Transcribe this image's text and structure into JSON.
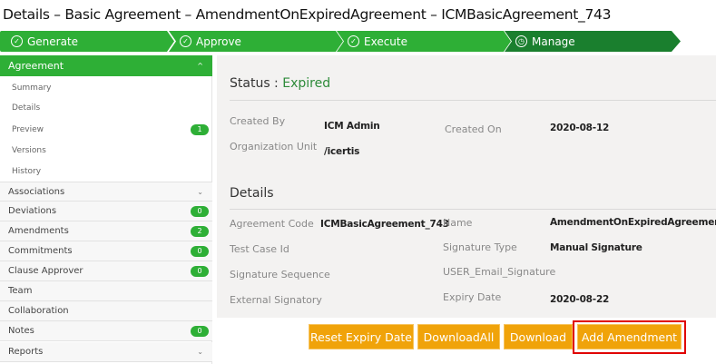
{
  "title": "Details – Basic Agreement – AmendmentOnExpiredAgreement – ICMBasicAgreement_743",
  "colors": {
    "green": "#2eaf36",
    "dark_green": "#1a7f2e",
    "orange": "#f0a30a",
    "highlight": "#e00000"
  },
  "steps": [
    {
      "label": "Generate",
      "icon": "check-circle-icon",
      "state": "done"
    },
    {
      "label": "Approve",
      "icon": "check-circle-icon",
      "state": "done"
    },
    {
      "label": "Execute",
      "icon": "check-circle-icon",
      "state": "done"
    },
    {
      "label": "Manage",
      "icon": "clock-icon",
      "state": "current"
    }
  ],
  "sidebar": {
    "header": "Agreement",
    "sub_items": [
      "Summary",
      "Details",
      "Preview",
      "Versions",
      "History"
    ],
    "preview_badge": "1",
    "sections": [
      {
        "label": "Associations",
        "chevron": true
      },
      {
        "label": "Deviations",
        "badge": "0"
      },
      {
        "label": "Amendments",
        "badge": "2"
      },
      {
        "label": "Commitments",
        "badge": "0"
      },
      {
        "label": "Clause Approver",
        "badge": "0"
      },
      {
        "label": "Team"
      },
      {
        "label": "Collaboration"
      },
      {
        "label": "Notes",
        "badge": "0"
      },
      {
        "label": "Reports",
        "chevron": true
      }
    ]
  },
  "status": {
    "label": "Status :",
    "value": "Expired"
  },
  "info": {
    "created_by_label": "Created By",
    "created_by": "ICM Admin",
    "org_unit_label": "Organization Unit",
    "org_unit": "/icertis",
    "created_on_label": "Created On",
    "created_on": "2020-08-12"
  },
  "details": {
    "heading": "Details",
    "agreement_code_label": "Agreement Code",
    "agreement_code": "ICMBasicAgreement_743",
    "test_case_label": "Test Case Id",
    "sig_seq_label": "Signature Sequence",
    "ext_sig_label": "External Signatory",
    "name_label": "Name",
    "name": "AmendmentOnExpiredAgreement",
    "sig_type_label": "Signature Type",
    "sig_type": "Manual Signature",
    "user_email_label": "USER_Email_Signature",
    "expiry_label": "Expiry Date",
    "expiry": "2020-08-22"
  },
  "buttons": {
    "reset": "Reset Expiry Date",
    "download_all": "DownloadAll",
    "download": "Download",
    "add_amendment": "Add Amendment"
  }
}
